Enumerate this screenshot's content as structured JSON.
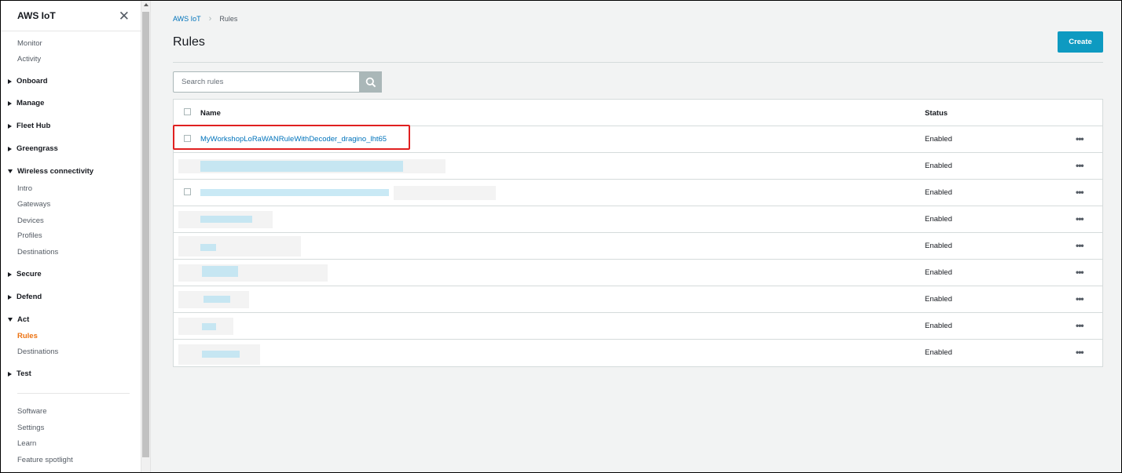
{
  "sidebar": {
    "title": "AWS IoT",
    "close_icon": "close-icon",
    "items": [
      {
        "label": "Monitor",
        "kind": "item"
      },
      {
        "label": "Activity",
        "kind": "item"
      },
      {
        "label": "Onboard",
        "kind": "group",
        "expanded": false
      },
      {
        "label": "Manage",
        "kind": "group",
        "expanded": false
      },
      {
        "label": "Fleet Hub",
        "kind": "group",
        "expanded": false
      },
      {
        "label": "Greengrass",
        "kind": "group",
        "expanded": false
      },
      {
        "label": "Wireless connectivity",
        "kind": "group",
        "expanded": true
      },
      {
        "label": "Intro",
        "kind": "item"
      },
      {
        "label": "Gateways",
        "kind": "item"
      },
      {
        "label": "Devices",
        "kind": "item"
      },
      {
        "label": "Profiles",
        "kind": "item"
      },
      {
        "label": "Destinations",
        "kind": "item"
      },
      {
        "label": "Secure",
        "kind": "group",
        "expanded": false
      },
      {
        "label": "Defend",
        "kind": "group",
        "expanded": false
      },
      {
        "label": "Act",
        "kind": "group",
        "expanded": true
      },
      {
        "label": "Rules",
        "kind": "item",
        "active": true
      },
      {
        "label": "Destinations",
        "kind": "item"
      },
      {
        "label": "Test",
        "kind": "group",
        "expanded": false
      }
    ],
    "footer_items": [
      "Software",
      "Settings",
      "Learn",
      "Feature spotlight"
    ]
  },
  "breadcrumb": {
    "parent": "AWS IoT",
    "current": "Rules"
  },
  "page": {
    "title": "Rules",
    "create_label": "Create"
  },
  "search": {
    "placeholder": "Search rules",
    "value": ""
  },
  "table": {
    "columns": {
      "name": "Name",
      "status": "Status"
    },
    "rows": [
      {
        "name": "MyWorkshopLoRaWANRuleWithDecoder_dragino_lht65",
        "status": "Enabled",
        "redacted": false
      },
      {
        "name": "",
        "status": "Enabled",
        "redacted": true
      },
      {
        "name": "",
        "status": "Enabled",
        "redacted": true
      },
      {
        "name": "",
        "status": "Enabled",
        "redacted": true
      },
      {
        "name": "",
        "status": "Enabled",
        "redacted": true
      },
      {
        "name": "",
        "status": "Enabled",
        "redacted": true
      },
      {
        "name": "",
        "status": "Enabled",
        "redacted": true
      },
      {
        "name": "",
        "status": "Enabled",
        "redacted": true
      },
      {
        "name": "",
        "status": "Enabled",
        "redacted": true
      }
    ],
    "row_menu_glyph": "•••"
  },
  "colors": {
    "accent": "#0e9ac1",
    "link": "#0073bb",
    "active_nav": "#ec7211",
    "highlight": "#e02020"
  }
}
